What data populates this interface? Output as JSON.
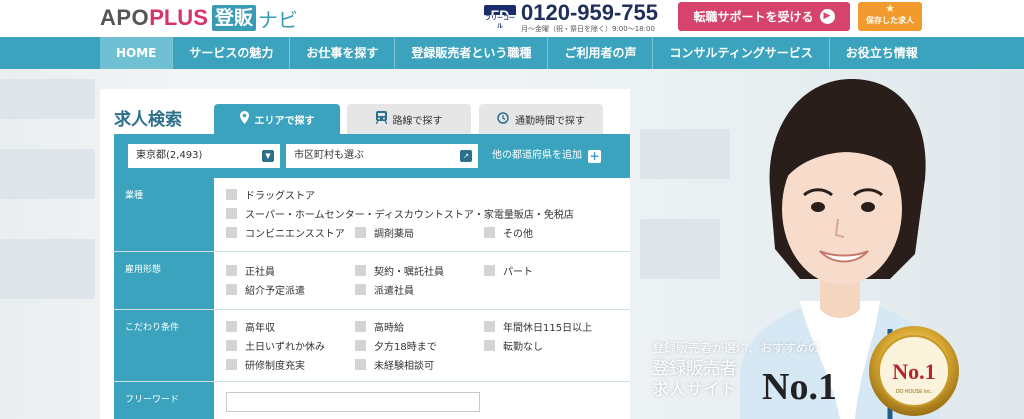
{
  "brand": {
    "apo": "APO",
    "plus": "PLUS",
    "kanji": "登販",
    "navi": "ナビ"
  },
  "phone": {
    "icon_text": "FD",
    "icon_caption": "フリーコール",
    "number": "0120-959-755",
    "hours": "月〜金曜（祝・祭日を除く）9:00〜18:00"
  },
  "header_buttons": {
    "support": "転職サポートを受ける",
    "support_arrow": "▶",
    "saved": "保存した求人",
    "saved_star": "★"
  },
  "nav": {
    "items": [
      "HOME",
      "サービスの魅力",
      "お仕事を探す",
      "登録販売者という職種",
      "ご利用者の声",
      "コンサルティングサービス",
      "お役立ち情報"
    ],
    "active_index": 0
  },
  "search": {
    "title": "求人検索",
    "tabs": [
      {
        "label": "エリアで探す",
        "icon": "map-pin-icon",
        "active": true
      },
      {
        "label": "路線で探す",
        "icon": "train-icon",
        "active": false
      },
      {
        "label": "通勤時間で探す",
        "icon": "clock-icon",
        "active": false
      }
    ],
    "prefecture": "東京都(2,493)",
    "city_placeholder": "市区町村も選ぶ",
    "add_prefecture": "他の都道府県を追加",
    "filters": {
      "industry": {
        "label": "業種",
        "options": [
          "ドラッグストア",
          "スーパー・ホームセンター・ディスカウントストア・家電量販店・免税店",
          "コンビニエンスストア",
          "調剤薬局",
          "その他"
        ]
      },
      "employment": {
        "label": "雇用形態",
        "options": [
          "正社員",
          "契約・嘱託社員",
          "パート",
          "紹介予定派遣",
          "派遣社員"
        ]
      },
      "conditions": {
        "label": "こだわり条件",
        "options": [
          "高年収",
          "高時給",
          "年間休日115日以上",
          "土日いずれか休み",
          "夕方18時まで",
          "転勤なし",
          "研修制度充実",
          "未経験相談可"
        ]
      },
      "freeword": {
        "label": "フリーワード"
      }
    }
  },
  "promo": {
    "subtitle": "登録販売者が選ぶ、おすすめの",
    "title_line1": "登録販売者",
    "title_line2": "求人サイト",
    "no1": "No.1",
    "asterisk": "※",
    "medal_text": "No.1",
    "medal_caption": "DO HOUSE Inc."
  },
  "colors": {
    "accent": "#3ba3bd",
    "support_button": "#d6446e",
    "saved_button": "#f19a2e"
  }
}
